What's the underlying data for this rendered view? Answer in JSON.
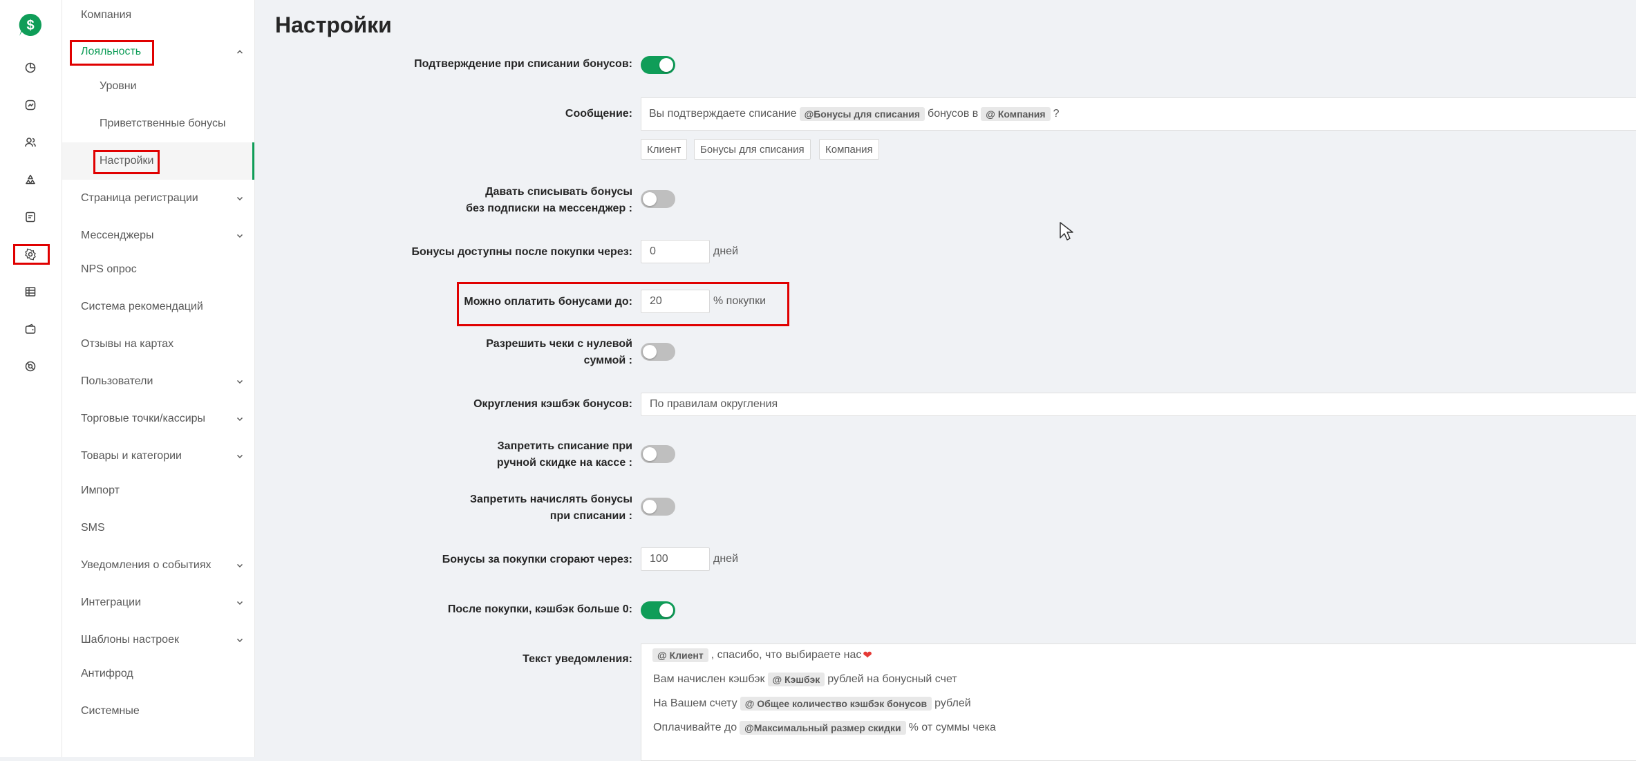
{
  "colors": {
    "brand": "#0f9d58",
    "highlight": "#e00000",
    "toggle_off": "#bfbfbf"
  },
  "rail": {
    "icons": [
      "logo-dollar-icon",
      "dashboard-icon",
      "analytics-icon",
      "users-icon",
      "recycle-icon",
      "reports-icon",
      "settings-icon",
      "table-icon",
      "wallet-icon",
      "support-icon"
    ]
  },
  "nav": {
    "company": "Компания",
    "loyalty": "Лояльность",
    "levels": "Уровни",
    "welcome_bonuses": "Приветственные бонусы",
    "settings": "Настройки",
    "registration_page": "Страница регистрации",
    "messengers": "Мессенджеры",
    "nps": "NPS опрос",
    "recommendations": "Система рекомендаций",
    "map_reviews": "Отзывы на картах",
    "users": "Пользователи",
    "points": "Торговые точки/кассиры",
    "products": "Товары и категории",
    "import": "Импорт",
    "sms": "SMS",
    "event_notifications": "Уведомления о событиях",
    "integrations": "Интеграции",
    "templates": "Шаблоны настроек",
    "antifraud": "Антифрод",
    "system": "Системные"
  },
  "main": {
    "title": "Настройки",
    "confirm_writeoff": {
      "label": "Подтверждение при списании бонусов:",
      "enabled": true
    },
    "message": {
      "label": "Сообщение:",
      "text_1": "Вы подтверждаете списание",
      "tag_1": "@Бонусы для списания",
      "text_2": "бонусов в",
      "tag_2": "@ Компания",
      "text_3": "?",
      "buttons": [
        "Клиент",
        "Бонусы для списания",
        "Компания"
      ]
    },
    "writeoff_without_sub": {
      "label_1": "Давать списывать бонусы",
      "label_2": "без подписки на мессенджер :",
      "enabled": false
    },
    "available_after": {
      "label": "Бонусы доступны после покупки через:",
      "value": "0",
      "unit": "дней"
    },
    "pay_up_to": {
      "label": "Можно оплатить бонусами до:",
      "value": "20",
      "unit": "% покупки"
    },
    "zero_checks": {
      "label_1": "Разрешить чеки с нулевой",
      "label_2": "суммой :",
      "enabled": false
    },
    "rounding": {
      "label": "Округления кэшбэк бонусов:",
      "value": "По правилам округления"
    },
    "forbid_manual_discount": {
      "label_1": "Запретить списание при",
      "label_2": "ручной скидке на кассе :",
      "enabled": false
    },
    "forbid_accrual": {
      "label_1": "Запретить начислять бонусы",
      "label_2": "при списании :",
      "enabled": false
    },
    "expire_after": {
      "label": "Бонусы за покупки сгорают через:",
      "value": "100",
      "unit": "дней"
    },
    "after_purchase": {
      "label": "После покупки, кэшбэк больше 0:",
      "enabled": true
    },
    "notification": {
      "label": "Текст уведомления:",
      "l1_tag": "@ Клиент",
      "l1_text": ", спасибо, что выбираете нас",
      "l1_heart": "❤",
      "l2_text_a": "Вам начислен кэшбэк",
      "l2_tag": "@ Кэшбэк",
      "l2_text_b": "рублей на бонусный счет",
      "l3_text_a": "На Вашем счету",
      "l3_tag": "@ Общее количество кэшбэк бонусов",
      "l3_text_b": "рублей",
      "l4_text_a": "Оплачивайте до",
      "l4_tag": "@Максимальный размер скидки",
      "l4_text_b": "% от суммы чека"
    }
  }
}
